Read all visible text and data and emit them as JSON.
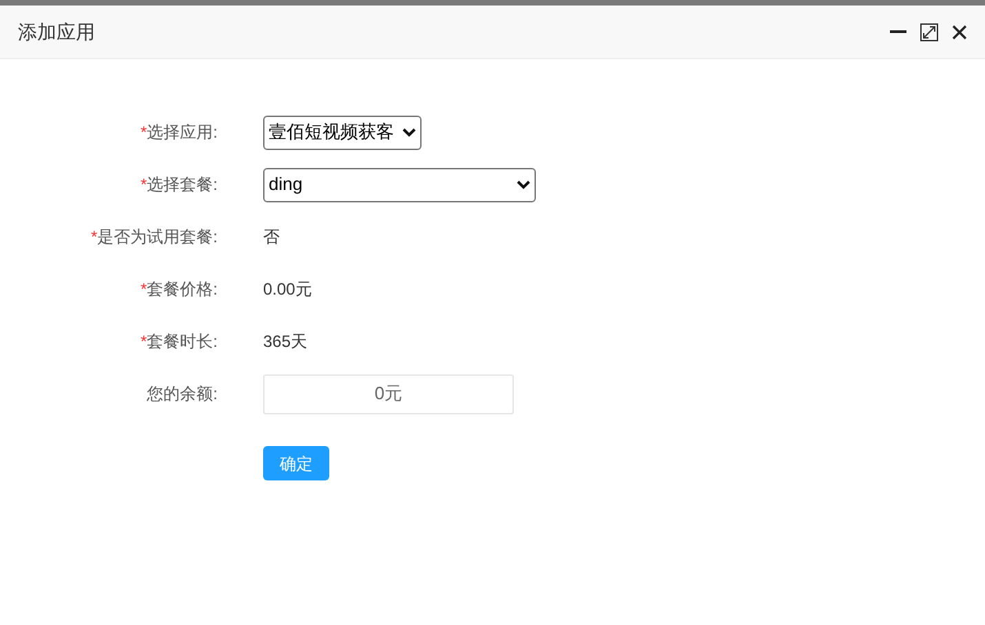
{
  "window": {
    "title": "添加应用"
  },
  "required_mark": "*",
  "fields": [
    {
      "label": "选择应用:",
      "required": true,
      "kind": "select",
      "value": "壹佰短视频获客"
    },
    {
      "label": "选择套餐:",
      "required": true,
      "kind": "select",
      "value": "ding"
    },
    {
      "label": "是否为试用套餐:",
      "required": true,
      "kind": "text",
      "value": "否"
    },
    {
      "label": "套餐价格:",
      "required": true,
      "kind": "text",
      "value": "0.00元"
    },
    {
      "label": "套餐时长:",
      "required": true,
      "kind": "text",
      "value": "365天"
    },
    {
      "label": "您的余额:",
      "required": false,
      "kind": "input",
      "value": "0元"
    }
  ],
  "buttons": [
    "确定"
  ]
}
